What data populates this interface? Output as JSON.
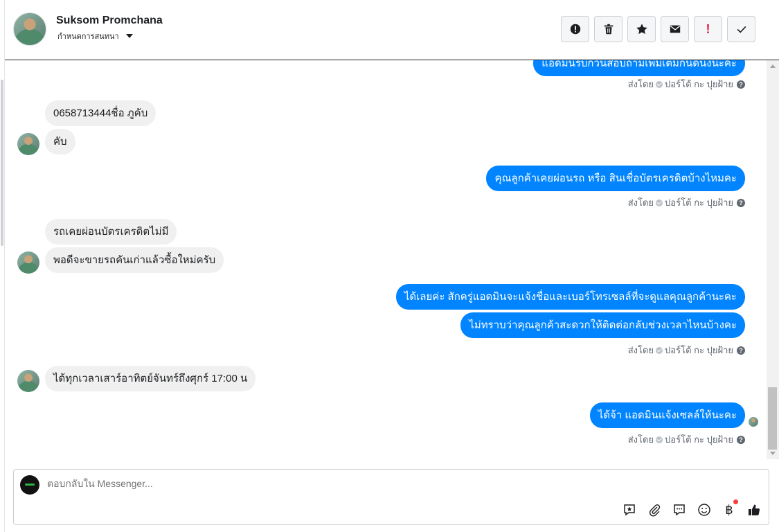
{
  "contact": {
    "name": "Suksom Promchana",
    "subtitle": "กำหนดการสนทนา"
  },
  "toolbar": {
    "buttons": [
      "spam-icon",
      "trash-icon",
      "star-icon",
      "mail-icon",
      "exclamation-icon",
      "check-icon"
    ],
    "exclamation_glyph": "!"
  },
  "thread": {
    "top_partial_message": "แอดมินรบกวนสอบถามเพิ่มเติมกันดนิงนะคะ",
    "sent_by_label": "ส่งโดย",
    "sender_name": "ปอร์โต้ กะ ปุยฝ้าย",
    "help_glyph": "?",
    "messages": [
      {
        "dir": "in",
        "text": "0658713444ชื่อ ภูคับ"
      },
      {
        "dir": "in",
        "text": "คับ"
      },
      {
        "dir": "out",
        "text": "คุณลูกค้าเคยผ่อนรถ หรือ สินเชื่อบัตรเครดิตบ้างไหมคะ"
      },
      {
        "dir": "in",
        "text": "รถเคยผ่อนบัตรเครดิตไม่มี"
      },
      {
        "dir": "in",
        "text": "พอดีจะขายรถคันเก่าแล้วซื้อใหม่ครับ"
      },
      {
        "dir": "out",
        "text": "ได้เลยค่ะ สักครู่แอดมินจะแจ้งชื่อและเบอร์โทรเซลล์ที่จะดูแลคุณลูกค้านะคะ"
      },
      {
        "dir": "out",
        "text": "ไม่ทราบว่าคุณลูกค้าสะดวกให้ติดต่อกลับช่วงเวลาไหนบ้างคะ"
      },
      {
        "dir": "in",
        "text": "ได้ทุกเวลาเสาร์อาทิตย์จันทร์ถึงศุกร์ 17:00 น"
      },
      {
        "dir": "out",
        "text": "ได้จ้า แอดมินแจ้งเซลล์ให้นะคะ"
      }
    ]
  },
  "composer": {
    "placeholder": "ตอบกลับใน Messenger...",
    "tools": [
      "saved-reply-icon",
      "attachment-icon",
      "comment-icon",
      "emoji-icon",
      "baht-icon",
      "like-icon"
    ],
    "baht_glyph": "฿"
  },
  "colors": {
    "outgoing": "#0084ff",
    "incoming": "#f0f0f0",
    "notification": "#fa3e3e"
  }
}
